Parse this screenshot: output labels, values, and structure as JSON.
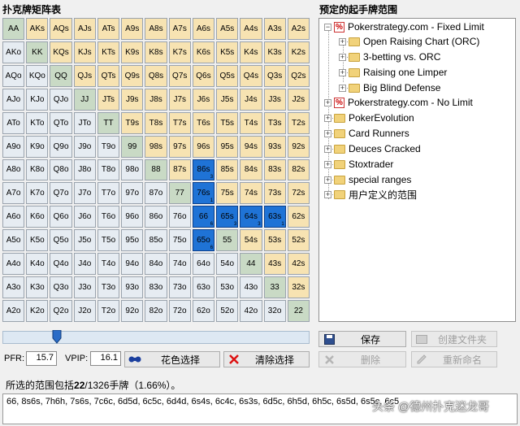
{
  "matrix_title": "扑克牌矩阵表",
  "tree_title": "预定的起手牌范围",
  "grid": [
    [
      [
        "AA",
        "pair"
      ],
      [
        "AKs",
        "suited"
      ],
      [
        "AQs",
        "suited"
      ],
      [
        "AJs",
        "suited"
      ],
      [
        "ATs",
        "suited"
      ],
      [
        "A9s",
        "suited"
      ],
      [
        "A8s",
        "suited"
      ],
      [
        "A7s",
        "suited"
      ],
      [
        "A6s",
        "suited"
      ],
      [
        "A5s",
        "suited"
      ],
      [
        "A4s",
        "suited"
      ],
      [
        "A3s",
        "suited"
      ],
      [
        "A2s",
        "suited"
      ]
    ],
    [
      [
        "AKo",
        "offsuit"
      ],
      [
        "KK",
        "pair"
      ],
      [
        "KQs",
        "suited"
      ],
      [
        "KJs",
        "suited"
      ],
      [
        "KTs",
        "suited"
      ],
      [
        "K9s",
        "suited"
      ],
      [
        "K8s",
        "suited"
      ],
      [
        "K7s",
        "suited"
      ],
      [
        "K6s",
        "suited"
      ],
      [
        "K5s",
        "suited"
      ],
      [
        "K4s",
        "suited"
      ],
      [
        "K3s",
        "suited"
      ],
      [
        "K2s",
        "suited"
      ]
    ],
    [
      [
        "AQo",
        "offsuit"
      ],
      [
        "KQo",
        "offsuit"
      ],
      [
        "QQ",
        "pair"
      ],
      [
        "QJs",
        "suited"
      ],
      [
        "QTs",
        "suited"
      ],
      [
        "Q9s",
        "suited"
      ],
      [
        "Q8s",
        "suited"
      ],
      [
        "Q7s",
        "suited"
      ],
      [
        "Q6s",
        "suited"
      ],
      [
        "Q5s",
        "suited"
      ],
      [
        "Q4s",
        "suited"
      ],
      [
        "Q3s",
        "suited"
      ],
      [
        "Q2s",
        "suited"
      ]
    ],
    [
      [
        "AJo",
        "offsuit"
      ],
      [
        "KJo",
        "offsuit"
      ],
      [
        "QJo",
        "offsuit"
      ],
      [
        "JJ",
        "pair"
      ],
      [
        "JTs",
        "suited"
      ],
      [
        "J9s",
        "suited"
      ],
      [
        "J8s",
        "suited"
      ],
      [
        "J7s",
        "suited"
      ],
      [
        "J6s",
        "suited"
      ],
      [
        "J5s",
        "suited"
      ],
      [
        "J4s",
        "suited"
      ],
      [
        "J3s",
        "suited"
      ],
      [
        "J2s",
        "suited"
      ]
    ],
    [
      [
        "ATo",
        "offsuit"
      ],
      [
        "KTo",
        "offsuit"
      ],
      [
        "QTo",
        "offsuit"
      ],
      [
        "JTo",
        "offsuit"
      ],
      [
        "TT",
        "pair"
      ],
      [
        "T9s",
        "suited"
      ],
      [
        "T8s",
        "suited"
      ],
      [
        "T7s",
        "suited"
      ],
      [
        "T6s",
        "suited"
      ],
      [
        "T5s",
        "suited"
      ],
      [
        "T4s",
        "suited"
      ],
      [
        "T3s",
        "suited"
      ],
      [
        "T2s",
        "suited"
      ]
    ],
    [
      [
        "A9o",
        "offsuit"
      ],
      [
        "K9o",
        "offsuit"
      ],
      [
        "Q9o",
        "offsuit"
      ],
      [
        "J9o",
        "offsuit"
      ],
      [
        "T9o",
        "offsuit"
      ],
      [
        "99",
        "pair"
      ],
      [
        "98s",
        "suited"
      ],
      [
        "97s",
        "suited"
      ],
      [
        "96s",
        "suited"
      ],
      [
        "95s",
        "suited"
      ],
      [
        "94s",
        "suited"
      ],
      [
        "93s",
        "suited"
      ],
      [
        "92s",
        "suited"
      ]
    ],
    [
      [
        "A8o",
        "offsuit"
      ],
      [
        "K8o",
        "offsuit"
      ],
      [
        "Q8o",
        "offsuit"
      ],
      [
        "J8o",
        "offsuit"
      ],
      [
        "T8o",
        "offsuit"
      ],
      [
        "98o",
        "offsuit"
      ],
      [
        "88",
        "pair"
      ],
      [
        "87s",
        "suited"
      ],
      [
        "86s",
        "sel",
        "3"
      ],
      [
        "85s",
        "suited"
      ],
      [
        "84s",
        "suited"
      ],
      [
        "83s",
        "suited"
      ],
      [
        "82s",
        "suited"
      ]
    ],
    [
      [
        "A7o",
        "offsuit"
      ],
      [
        "K7o",
        "offsuit"
      ],
      [
        "Q7o",
        "offsuit"
      ],
      [
        "J7o",
        "offsuit"
      ],
      [
        "T7o",
        "offsuit"
      ],
      [
        "97o",
        "offsuit"
      ],
      [
        "87o",
        "offsuit"
      ],
      [
        "77",
        "pair"
      ],
      [
        "76s",
        "sel",
        "1"
      ],
      [
        "75s",
        "suited"
      ],
      [
        "74s",
        "suited"
      ],
      [
        "73s",
        "suited"
      ],
      [
        "72s",
        "suited"
      ]
    ],
    [
      [
        "A6o",
        "offsuit"
      ],
      [
        "K6o",
        "offsuit"
      ],
      [
        "Q6o",
        "offsuit"
      ],
      [
        "J6o",
        "offsuit"
      ],
      [
        "T6o",
        "offsuit"
      ],
      [
        "96o",
        "offsuit"
      ],
      [
        "86o",
        "offsuit"
      ],
      [
        "76o",
        "offsuit"
      ],
      [
        "66",
        "sel",
        "6"
      ],
      [
        "65s",
        "sel",
        "3"
      ],
      [
        "64s",
        "sel",
        "3"
      ],
      [
        "63s",
        "sel",
        "1"
      ],
      [
        "62s",
        "suited"
      ]
    ],
    [
      [
        "A5o",
        "offsuit"
      ],
      [
        "K5o",
        "offsuit"
      ],
      [
        "Q5o",
        "offsuit"
      ],
      [
        "J5o",
        "offsuit"
      ],
      [
        "T5o",
        "offsuit"
      ],
      [
        "95o",
        "offsuit"
      ],
      [
        "85o",
        "offsuit"
      ],
      [
        "75o",
        "offsuit"
      ],
      [
        "65o",
        "sel",
        "6"
      ],
      [
        "55",
        "pair"
      ],
      [
        "54s",
        "suited"
      ],
      [
        "53s",
        "suited"
      ],
      [
        "52s",
        "suited"
      ]
    ],
    [
      [
        "A4o",
        "offsuit"
      ],
      [
        "K4o",
        "offsuit"
      ],
      [
        "Q4o",
        "offsuit"
      ],
      [
        "J4o",
        "offsuit"
      ],
      [
        "T4o",
        "offsuit"
      ],
      [
        "94o",
        "offsuit"
      ],
      [
        "84o",
        "offsuit"
      ],
      [
        "74o",
        "offsuit"
      ],
      [
        "64o",
        "offsuit"
      ],
      [
        "54o",
        "offsuit"
      ],
      [
        "44",
        "pair"
      ],
      [
        "43s",
        "suited"
      ],
      [
        "42s",
        "suited"
      ]
    ],
    [
      [
        "A3o",
        "offsuit"
      ],
      [
        "K3o",
        "offsuit"
      ],
      [
        "Q3o",
        "offsuit"
      ],
      [
        "J3o",
        "offsuit"
      ],
      [
        "T3o",
        "offsuit"
      ],
      [
        "93o",
        "offsuit"
      ],
      [
        "83o",
        "offsuit"
      ],
      [
        "73o",
        "offsuit"
      ],
      [
        "63o",
        "offsuit"
      ],
      [
        "53o",
        "offsuit"
      ],
      [
        "43o",
        "offsuit"
      ],
      [
        "33",
        "pair"
      ],
      [
        "32s",
        "suited"
      ]
    ],
    [
      [
        "A2o",
        "offsuit"
      ],
      [
        "K2o",
        "offsuit"
      ],
      [
        "Q2o",
        "offsuit"
      ],
      [
        "J2o",
        "offsuit"
      ],
      [
        "T2o",
        "offsuit"
      ],
      [
        "92o",
        "offsuit"
      ],
      [
        "82o",
        "offsuit"
      ],
      [
        "72o",
        "offsuit"
      ],
      [
        "62o",
        "offsuit"
      ],
      [
        "52o",
        "offsuit"
      ],
      [
        "42o",
        "offsuit"
      ],
      [
        "32o",
        "offsuit"
      ],
      [
        "22",
        "pair"
      ]
    ]
  ],
  "slider_value_fraction": 0.16,
  "pfr": {
    "label": "PFR:",
    "value": "15.7"
  },
  "vpip": {
    "label": "VPIP:",
    "value": "16.1"
  },
  "buttons": {
    "suit_select": "花色选择",
    "clear_select": "清除选择",
    "save": "保存",
    "delete": "删除",
    "create_folder": "创建文件夹",
    "rename": "重新命名"
  },
  "tree": {
    "pokerstrategy_fixed": "Pokerstrategy.com - Fixed Limit",
    "children": [
      "Open Raising Chart (ORC)",
      "3-betting vs. ORC",
      "Raising one Limper",
      "Big Blind Defense"
    ],
    "pokerstrategy_nl": "Pokerstrategy.com - No Limit",
    "others": [
      "PokerEvolution",
      "Card Runners",
      "Deuces Cracked",
      "Stoxtrader",
      "special ranges",
      "用户定义的范围"
    ]
  },
  "summary": {
    "prefix": "所选的范围包括",
    "count": "22",
    "total": "/1326手牌（1.66%）。"
  },
  "combos": "66, 8s6s, 7h6h, 7s6s, 7c6c, 6d5d, 6c5c, 6d4d, 6s4s, 6c4c, 6s3s, 6d5c, 6h5d, 6h5c, 6s5d, 6s5c, 6c5",
  "watermark": "头条 @德州扑克迷龙哥",
  "colors": {
    "pair": "#c9dac5",
    "suited": "#f7e3b2",
    "offsuit": "#e6ecf2",
    "selected": "#1f73d6"
  }
}
